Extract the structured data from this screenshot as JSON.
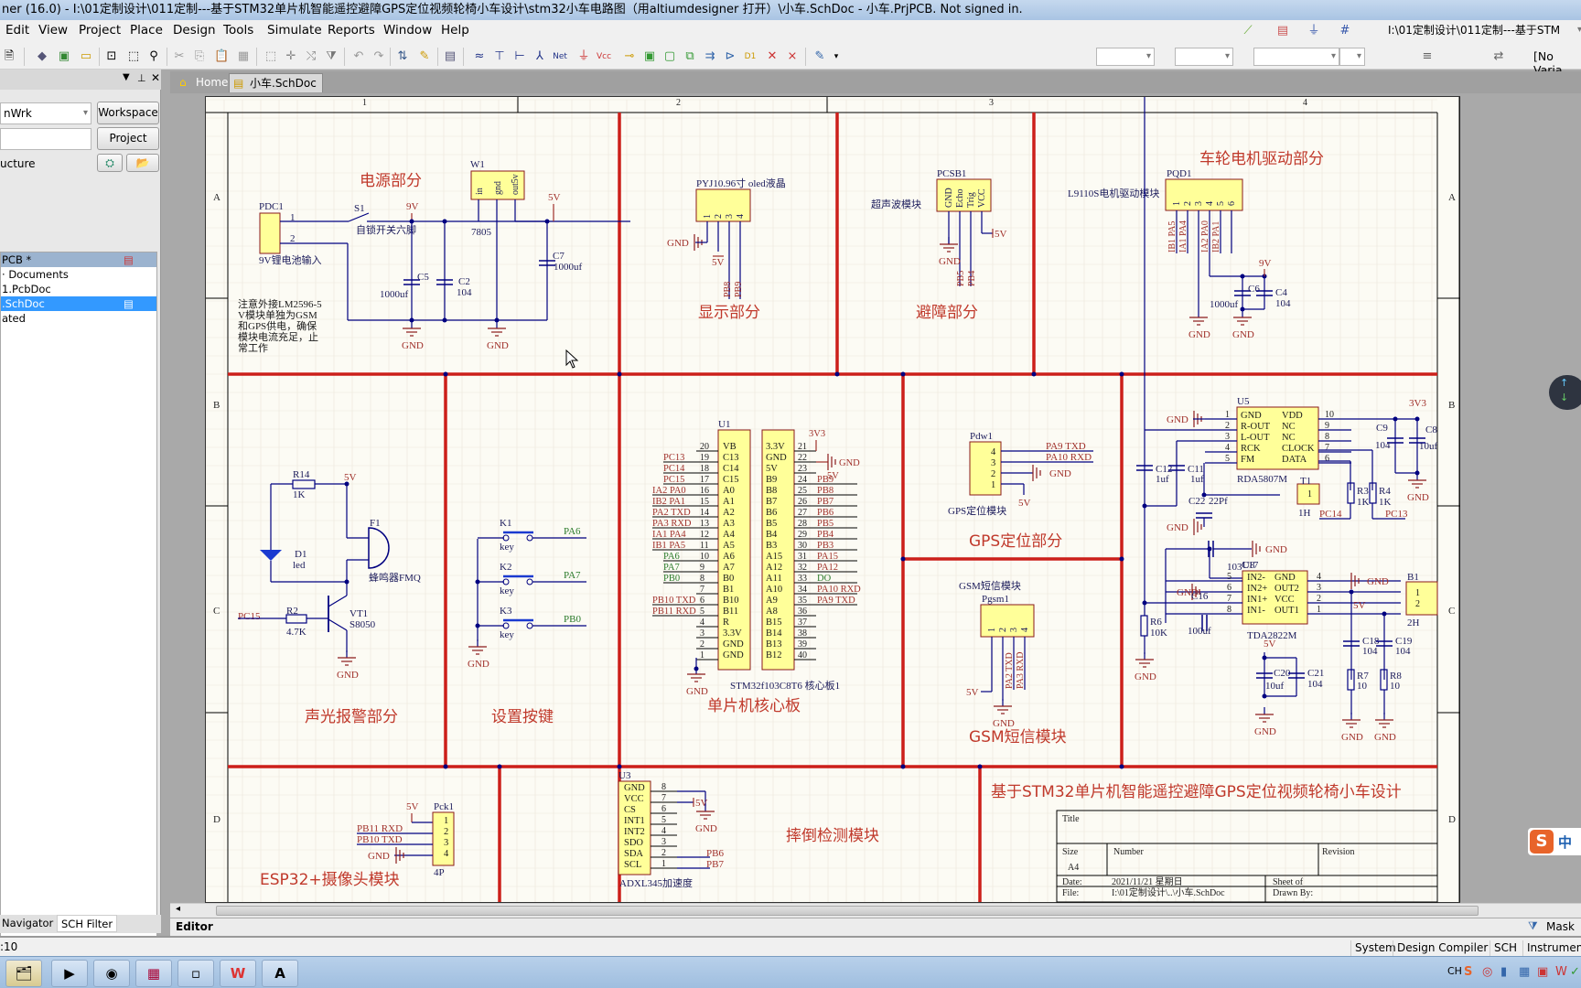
{
  "window": {
    "title": "ner (16.0) - I:\\01定制设计\\011定制---基于STM32单片机智能遥控避障GPS定位视频轮椅小车设计\\stm32小车电路图（用altiumdesigner 打开）\\小车.SchDoc - 小车.PrjPCB. Not signed in."
  },
  "menu": [
    "Edit",
    "View",
    "Project",
    "Place",
    "Design",
    "Tools",
    "Simulate",
    "Reports",
    "Window",
    "Help"
  ],
  "toolbar": {
    "path_combo": "I:\\01定制设计\\011定制---基于STM",
    "variant_combo": "[No Varia"
  },
  "panel": {
    "workspace_combo": "nWrk",
    "workspace_button": "Workspace",
    "project_button": "Project",
    "structure_label": "ucture",
    "tree": [
      {
        "label": "PCB *",
        "style": "project"
      },
      {
        "label": "Documents",
        "style": "normal"
      },
      {
        "label": "1.PcbDoc",
        "style": "normal"
      },
      {
        "label": ".SchDoc",
        "style": "selected"
      },
      {
        "label": "ated",
        "style": "normal"
      }
    ],
    "bottom_tabs": [
      "Navigator",
      "SCH Filter"
    ]
  },
  "doc_tabs": [
    {
      "label": "Home",
      "icon": "home-icon",
      "active": false
    },
    {
      "label": "小车.SchDoc",
      "icon": "schdoc-icon",
      "active": true
    }
  ],
  "schematic": {
    "col_labels": [
      "1",
      "2",
      "3",
      "4"
    ],
    "row_labels": [
      "A",
      "B",
      "C",
      "D"
    ],
    "sections": {
      "power": "电源部分",
      "display": "显示部分",
      "avoid": "避障部分",
      "motor": "车轮电机驱动部分",
      "alarm": "声光报警部分",
      "keys": "设置按键",
      "mcu": "单片机核心板",
      "gps": "GPS定位部分",
      "gsm": "GSM短信模块",
      "esp32": "ESP32+摄像头模块",
      "fall": "摔倒检测模块",
      "project_title": "基于STM32单片机智能遥控避障GPS定位视频轮椅小车设计"
    },
    "power": {
      "pdc1": "PDC1",
      "pdc1_desc": "9V锂电池输入",
      "s1": "S1",
      "s1_desc": "自锁开关六脚",
      "w1": "W1",
      "w1_part": "7805",
      "w1_pins": [
        "in",
        "gnd",
        "out5v"
      ],
      "c5": "C5",
      "c5_val": "1000uf",
      "c2": "C2",
      "c2_val": "104",
      "c7": "C7",
      "c7_val": "1000uf",
      "net_9v": "9V",
      "net_5v": "5V",
      "gnd": "GND",
      "note": [
        "注意外接LM2596-5",
        "V模块单独为GSM",
        "和GPS供电，确保",
        "模块电流充足，止",
        "常工作"
      ]
    },
    "display": {
      "ref": "PYJ10.96寸 oled液晶",
      "nets": [
        "GND",
        "5V",
        "PB8",
        "PB9"
      ]
    },
    "avoid": {
      "ref": "PCSB1",
      "desc": "超声波模块",
      "pins": [
        "GND",
        "Echo",
        "Trig",
        "VCC"
      ],
      "nets": [
        "GND",
        "PB5",
        "PB4",
        "5V"
      ]
    },
    "motor": {
      "ref": "PQD1",
      "desc": "L9110S电机驱动模块",
      "nets": [
        "IB1 PA5",
        "IA1 PA4",
        "IA2 PA0",
        "IB2 PA1"
      ],
      "c6": "C6",
      "c6_val": "1000uf",
      "c4": "C4",
      "c4_val": "104",
      "net_9v": "9V"
    },
    "alarm": {
      "r14": "R14",
      "r14_val": "1K",
      "d1": "D1",
      "d1_val": "led",
      "f1": "F1",
      "f1_desc": "蜂鸣器FMQ",
      "vt1": "VT1",
      "vt1_val": "S8050",
      "r2": "R2",
      "r2_val": "4.7K",
      "net_pc15": "PC15",
      "net_5v": "5V"
    },
    "keys": [
      {
        "ref": "K1",
        "val": "key",
        "net": "PA6"
      },
      {
        "ref": "K2",
        "val": "key",
        "net": "PA7"
      },
      {
        "ref": "K3",
        "val": "key",
        "net": "PB0"
      }
    ],
    "mcu": {
      "ref": "U1",
      "desc": "STM32f103C8T6 核心板1",
      "left_pins": [
        {
          "num": "20",
          "name": "VB",
          "net": ""
        },
        {
          "num": "19",
          "name": "C13",
          "net": "PC13"
        },
        {
          "num": "18",
          "name": "C14",
          "net": "PC14"
        },
        {
          "num": "17",
          "name": "C15",
          "net": "PC15"
        },
        {
          "num": "16",
          "name": "A0",
          "net": "IA2 PA0"
        },
        {
          "num": "15",
          "name": "A1",
          "net": "IB2 PA1"
        },
        {
          "num": "14",
          "name": "A2",
          "net": "PA2 TXD"
        },
        {
          "num": "13",
          "name": "A3",
          "net": "PA3 RXD"
        },
        {
          "num": "12",
          "name": "A4",
          "net": "IA1 PA4"
        },
        {
          "num": "11",
          "name": "A5",
          "net": "IB1 PA5"
        },
        {
          "num": "10",
          "name": "A6",
          "net": "PA6"
        },
        {
          "num": "9",
          "name": "A7",
          "net": "PA7"
        },
        {
          "num": "8",
          "name": "B0",
          "net": "PB0"
        },
        {
          "num": "7",
          "name": "B1",
          "net": ""
        },
        {
          "num": "6",
          "name": "B10",
          "net": "PB10 TXD"
        },
        {
          "num": "5",
          "name": "B11",
          "net": "PB11 RXD"
        },
        {
          "num": "4",
          "name": "R",
          "net": ""
        },
        {
          "num": "3",
          "name": "3.3V",
          "net": ""
        },
        {
          "num": "2",
          "name": "GND",
          "net": ""
        },
        {
          "num": "1",
          "name": "GND",
          "net": ""
        }
      ],
      "right_pins": [
        {
          "num": "21",
          "name": "3.3V",
          "net": "3V3"
        },
        {
          "num": "22",
          "name": "GND",
          "net": "GND"
        },
        {
          "num": "23",
          "name": "5V",
          "net": "5V"
        },
        {
          "num": "24",
          "name": "B9",
          "net": "PB9"
        },
        {
          "num": "25",
          "name": "B8",
          "net": "PB8"
        },
        {
          "num": "26",
          "name": "B7",
          "net": "PB7"
        },
        {
          "num": "27",
          "name": "B6",
          "net": "PB6"
        },
        {
          "num": "28",
          "name": "B5",
          "net": "PB5"
        },
        {
          "num": "29",
          "name": "B4",
          "net": "PB4"
        },
        {
          "num": "30",
          "name": "B3",
          "net": "PB3"
        },
        {
          "num": "31",
          "name": "A15",
          "net": "PA15"
        },
        {
          "num": "32",
          "name": "A12",
          "net": "PA12"
        },
        {
          "num": "33",
          "name": "A11",
          "net": "DO"
        },
        {
          "num": "34",
          "name": "A10",
          "net": "PA10 RXD"
        },
        {
          "num": "35",
          "name": "A9",
          "net": "PA9 TXD"
        },
        {
          "num": "36",
          "name": "A8",
          "net": ""
        },
        {
          "num": "37",
          "name": "B15",
          "net": ""
        },
        {
          "num": "38",
          "name": "B14",
          "net": ""
        },
        {
          "num": "39",
          "name": "B13",
          "net": ""
        },
        {
          "num": "40",
          "name": "B12",
          "net": ""
        }
      ],
      "gnd": "GND"
    },
    "gps": {
      "ref": "Pdw1",
      "desc": "GPS定位模块",
      "nets": [
        "PA9 TXD",
        "PA10 RXD",
        "GND",
        "5V"
      ],
      "pins": [
        "4",
        "3",
        "2",
        "1"
      ]
    },
    "gsm": {
      "ref": "Pgsm1",
      "desc": "GSM短信模块",
      "nets": [
        "5V",
        "GND",
        "PA2 TXD",
        "PA3 RXD"
      ]
    },
    "radio": {
      "u5": "U5",
      "u5_part": "RDA5807M",
      "u5_left": [
        [
          "1",
          "GND"
        ],
        [
          "2",
          "R-OUT"
        ],
        [
          "3",
          "L-OUT"
        ],
        [
          "4",
          "RCK"
        ],
        [
          "5",
          "FM"
        ]
      ],
      "u5_right": [
        [
          "10",
          "VDD"
        ],
        [
          "9",
          "NC"
        ],
        [
          "8",
          "NC"
        ],
        [
          "7",
          "CLOCK"
        ],
        [
          "6",
          "DATA"
        ]
      ],
      "c9": "C9",
      "c9_val": "104",
      "c8": "C8",
      "c8_val": "10uf",
      "net_3v3": "3V3",
      "c12": "C12",
      "c12_val": "1uf",
      "c11": "C11",
      "c11_val": "1uf",
      "c22": "C22",
      "c22_val": "22Pf",
      "t1": "T1",
      "t1_val": "1H",
      "r3": "R3",
      "r3_val": "1K",
      "r4": "R4",
      "r4_val": "1K",
      "net_pc14": "PC14",
      "net_pc13": "PC13",
      "c17": "C17",
      "c17_val": "103",
      "u8": "U8",
      "u8_part": "TDA2822M",
      "u8_left": [
        [
          "5",
          "IN2-"
        ],
        [
          "6",
          "IN2+"
        ],
        [
          "7",
          "IN1+"
        ],
        [
          "8",
          "IN1-"
        ]
      ],
      "u8_right": [
        [
          "4",
          "GND"
        ],
        [
          "3",
          "OUT2"
        ],
        [
          "2",
          "VCC"
        ],
        [
          "1",
          "OUT1"
        ]
      ],
      "c16": "C16",
      "c16_val": "100uf",
      "r6": "R6",
      "r6_val": "10K",
      "c20": "C20",
      "c20_val": "10uf",
      "c21": "C21",
      "c21_val": "104",
      "c18": "C18",
      "c18_val": "104",
      "c19": "C19",
      "c19_val": "104",
      "r7": "R7",
      "r7_val": "10",
      "r8": "R8",
      "r8_val": "10",
      "b1": "B1",
      "b1_val": "2H",
      "net_5v": "5V",
      "gnd": "GND"
    },
    "esp32": {
      "ref": "Pck1",
      "val": "4P",
      "nets": [
        "5V",
        "PB11 RXD",
        "PB10 TXD",
        "GND"
      ],
      "pins": [
        "1",
        "2",
        "3",
        "4"
      ]
    },
    "fall": {
      "ref": "U3",
      "desc": "ADXL345加速度",
      "pins": [
        [
          "8",
          "GND"
        ],
        [
          "7",
          "VCC"
        ],
        [
          "6",
          "CS"
        ],
        [
          "5",
          "INT1"
        ],
        [
          "4",
          "INT2"
        ],
        [
          "3",
          "SDO"
        ],
        [
          "2",
          "SDA"
        ],
        [
          "1",
          "SCL"
        ]
      ],
      "net_5v": "5V",
      "net_sda": "PB6",
      "net_scl": "PB7",
      "gnd": "GND"
    },
    "titleblock": {
      "title_label": "Title",
      "size_label": "Size",
      "size": "A4",
      "number_label": "Number",
      "revision_label": "Revision",
      "date_label": "Date:",
      "date": "2021/11/21 星期日",
      "sheet_label": "Sheet   of",
      "file_label": "File:",
      "file": "I:\\01定制设计\\..\\小车.SchDoc",
      "drawn_label": "Drawn By:"
    }
  },
  "editor_tab": "Editor",
  "mask_label": "Mask",
  "status": {
    "left": ":10",
    "tabs": [
      "System",
      "Design Compiler",
      "SCH",
      "Instrument"
    ]
  },
  "tray": {
    "lang": "CH"
  },
  "colors": {
    "border_red": "#cc1f1a",
    "wire": "#000080",
    "net_red": "#a0302a",
    "net_green": "#2a7a2a",
    "comp_fill": "#ffff99"
  }
}
